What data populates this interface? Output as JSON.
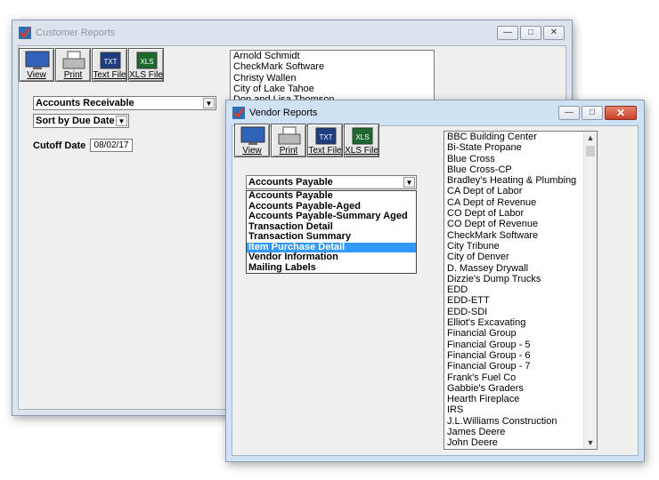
{
  "customer_window": {
    "title": "Customer Reports",
    "toolbar": {
      "view_label": "View",
      "print_label": "Print",
      "text_label": "Text File",
      "xls_label": "XLS File"
    },
    "report_combo_value": "Accounts Receivable",
    "sort_combo_value": "Sort by Due Date",
    "cutoff_label": "Cutoff Date",
    "cutoff_value": "08/02/17",
    "customers": [
      "Arnold Schmidt",
      "CheckMark Software",
      "Christy Wallen",
      "City of Lake Tahoe",
      "Don and Lisa Thomson"
    ]
  },
  "vendor_window": {
    "title": "Vendor Reports",
    "toolbar": {
      "view_label": "View",
      "print_label": "Print",
      "text_label": "Text File",
      "xls_label": "XLS File"
    },
    "report_combo_value": "Accounts Payable",
    "report_options": [
      "Accounts Payable",
      "Accounts Payable-Aged",
      "Accounts Payable-Summary Aged",
      "Transaction Detail",
      "Transaction Summary",
      "Item Purchase Detail",
      "Vendor Information",
      "Mailing Labels"
    ],
    "selected_option": "Item Purchase Detail",
    "vendors": [
      "BBC Building Center",
      "Bi-State Propane",
      "Blue Cross",
      "Blue Cross-CP",
      "Bradley's Heating & Plumbing",
      "CA Dept of Labor",
      "CA Dept of Revenue",
      "CO Dept of Labor",
      "CO Dept of Revenue",
      "CheckMark Software",
      "City Tribune",
      "City of Denver",
      "D. Massey Drywall",
      "Dizzie's Dump Trucks",
      "EDD",
      "EDD-ETT",
      "EDD-SDI",
      "Elliot's Excavating",
      "Financial Group",
      "Financial Group - 5",
      "Financial Group - 6",
      "Financial Group - 7",
      "Frank's Fuel Co",
      "Gabbie's Graders",
      "Hearth Fireplace",
      "IRS",
      "J.L.Williams Construction",
      "James Deere",
      "John Deere"
    ]
  },
  "icons": {
    "txt_badge": "TXT",
    "xls_badge": "XLS"
  },
  "colors": {
    "selection": "#3399ff",
    "close_button": "#c6432a",
    "active_frame": "#cfe1f5"
  }
}
